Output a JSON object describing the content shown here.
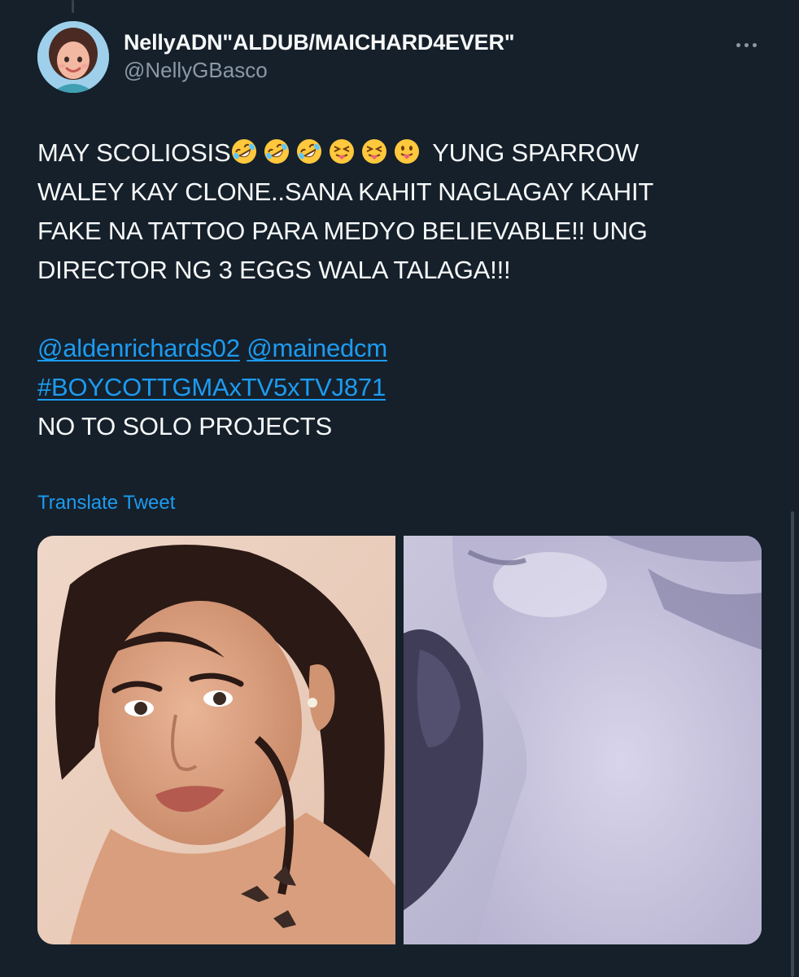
{
  "tweet": {
    "author": {
      "display_name": "NellyADN\"ALDUB/MAICHARD4EVER\"",
      "handle": "@NellyGBasco",
      "avatar_icon": "cartoon-woman-avatar-icon"
    },
    "text": {
      "line1_prefix": "MAY SCOLIOSIS",
      "line1_emojis": [
        "rolling-on-floor-laughing-icon",
        "rolling-on-floor-laughing-icon",
        "rolling-on-floor-laughing-icon",
        "squinting-tongue-face-icon",
        "squinting-tongue-face-icon",
        "tongue-face-icon"
      ],
      "line1_suffix": " YUNG SPARROW",
      "line2": "WALEY KAY CLONE..SANA KAHIT NAGLAGAY KAHIT",
      "line3": "FAKE NA TATTOO PARA MEDYO BELIEVABLE!! UNG",
      "line4": "DIRECTOR NG 3 EGGS WALA TALAGA!!!",
      "mention1": "@aldenrichards02",
      "mention2": "@mainedcm",
      "hashtag": "#BOYCOTTGMAxTV5xTVJ871",
      "closing": "NO TO SOLO PROJECTS"
    },
    "translate_label": "Translate Tweet",
    "media": [
      {
        "description_icon": "photo-woman-tattoo"
      },
      {
        "description_icon": "photo-blurry-shoulder"
      }
    ]
  },
  "colors": {
    "background": "#15202b",
    "text": "#f7f9f9",
    "secondary": "#8b98a5",
    "link": "#1d9bf0"
  }
}
